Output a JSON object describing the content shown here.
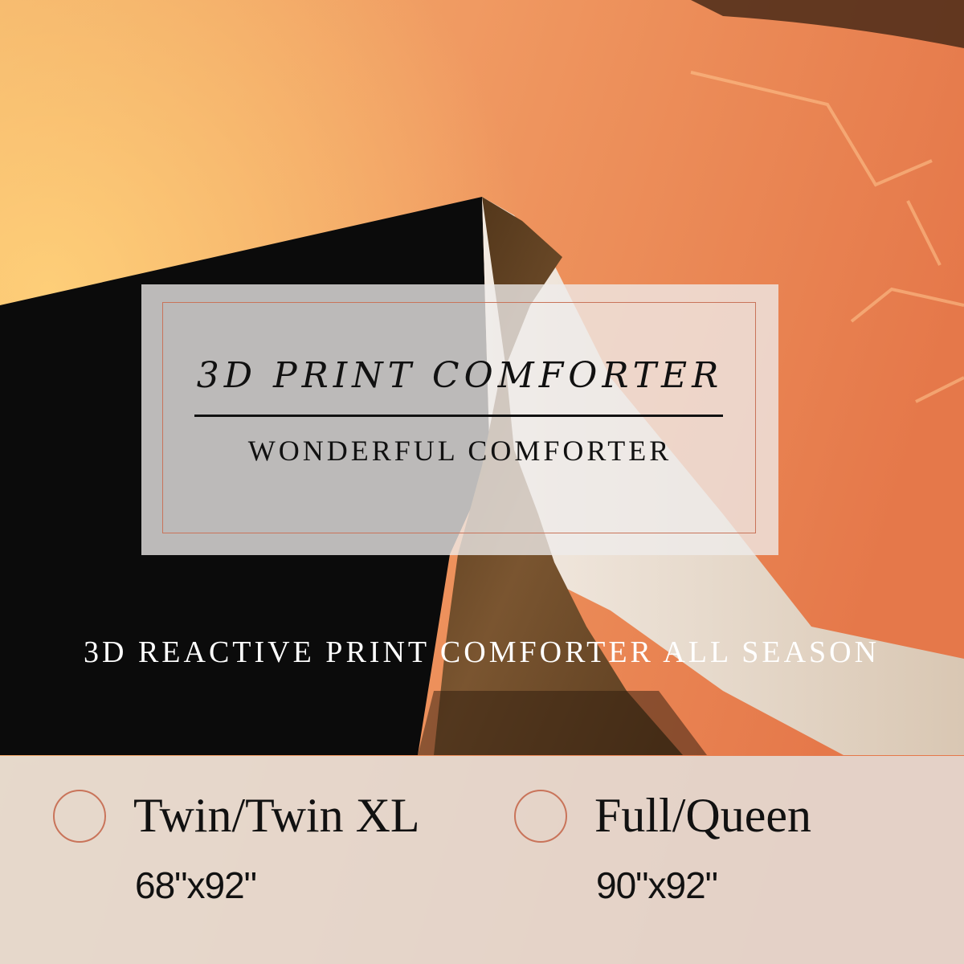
{
  "headline": "3D PRINT COMFORTER",
  "subhead": "WONDERFUL COMFORTER",
  "tagline": "3D REACTIVE PRINT COMFORTER ALL SEASON",
  "sizes": [
    {
      "name": "Twin/Twin XL",
      "dimensions": "68\"x92\""
    },
    {
      "name": "Full/Queen",
      "dimensions": "90\"x92\""
    }
  ],
  "colors": {
    "accent": "#c9745a",
    "text": "#111111",
    "background_orange": "#e88a55",
    "fabric_black": "#0b0b0b",
    "fabric_brown": "#6b4a2a"
  }
}
